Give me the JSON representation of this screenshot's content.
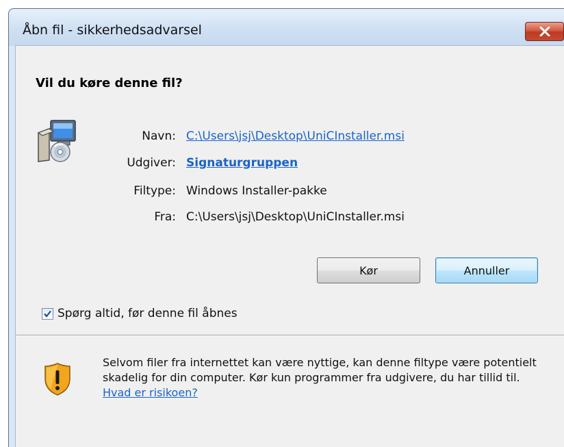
{
  "window": {
    "title": "Åbn fil - sikkerhedsadvarsel",
    "close_label": "x"
  },
  "dialog": {
    "question": "Vil du køre denne fil?",
    "file_icon": "installer-package-icon",
    "fields": {
      "name_label": "Navn:",
      "name_value": "C:\\Users\\jsj\\Desktop\\UniCInstaller.msi",
      "publisher_label": "Udgiver:",
      "publisher_value": "Signaturgruppen",
      "filetype_label": "Filtype:",
      "filetype_value": "Windows Installer-pakke",
      "from_label": "Fra:",
      "from_value": "C:\\Users\\jsj\\Desktop\\UniCInstaller.msi"
    },
    "buttons": {
      "run_label": "Kør",
      "cancel_label": "Annuller"
    },
    "checkbox": {
      "label": "Spørg altid, før denne fil åbnes",
      "checked": true
    }
  },
  "warning": {
    "icon": "shield-warning-icon",
    "text": "Selvom filer fra internettet kan være nyttige, kan denne filtype være potentielt skadelig for din computer. Kør kun programmer fra udgivere, du har tillid til.",
    "link_text": "Hvad er risikoen?"
  },
  "colors": {
    "link": "#1a64c8",
    "close_button": "#c4472f",
    "titlebar": "#d9e8f7",
    "shield_orange": "#f0a020"
  }
}
